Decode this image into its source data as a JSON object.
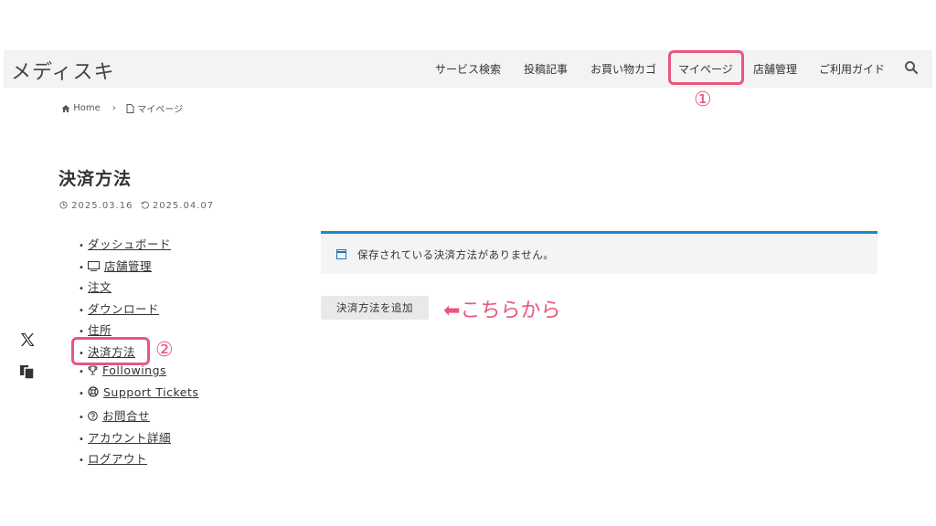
{
  "site": {
    "logo": "メディスキ"
  },
  "nav": {
    "items": [
      "サービス検索",
      "投稿記事",
      "お買い物カゴ",
      "マイページ",
      "店舗管理",
      "ご利用ガイド"
    ]
  },
  "breadcrumb": {
    "home": "Home",
    "separator": "›",
    "current": "マイページ"
  },
  "page": {
    "title": "決済方法",
    "published": "2025.03.16",
    "modified": "2025.04.07"
  },
  "menu": {
    "bullet": "•",
    "items": [
      {
        "label": "ダッシュボード"
      },
      {
        "label": "店舗管理",
        "icon": "monitor-icon"
      },
      {
        "label": "注文"
      },
      {
        "label": "ダウンロード"
      },
      {
        "label": "住所"
      },
      {
        "label": "決済方法"
      },
      {
        "label": "Followings",
        "icon": "trophy-icon"
      },
      {
        "label": "Support Tickets",
        "icon": "lifebuoy-icon"
      },
      {
        "label": "お問合せ",
        "icon": "question-icon"
      },
      {
        "label": "アカウント詳細"
      },
      {
        "label": "ログアウト"
      }
    ]
  },
  "notice": {
    "text": "保存されている決済方法がありません。"
  },
  "actions": {
    "add_payment": "決済方法を追加"
  },
  "annotations": {
    "step1": "①",
    "step2": "②",
    "arrow": "⬅",
    "hint": "こちらから"
  },
  "colors": {
    "accent": "#e8577e",
    "notice_border": "#1e88c7"
  }
}
